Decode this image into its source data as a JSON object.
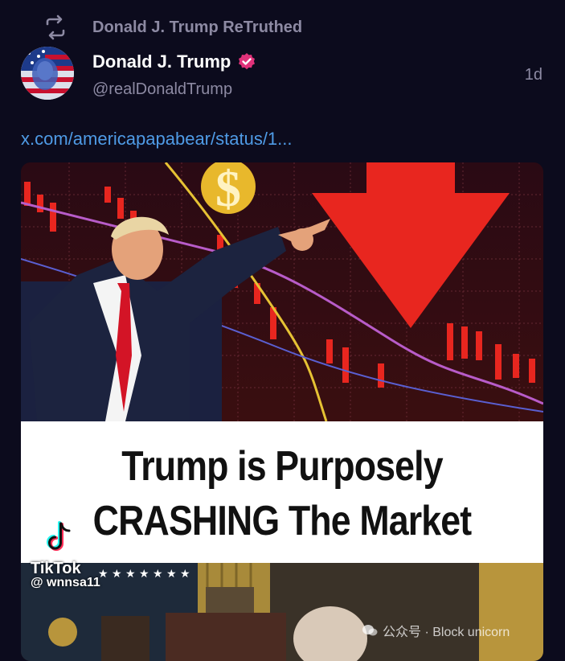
{
  "post": {
    "retruth_label": "Donald J. Trump ReTruthed",
    "author_name": "Donald J. Trump",
    "author_handle": "@realDonaldTrump",
    "timestamp": "1d",
    "link_text": "x.com/americapapabear/status/1..."
  },
  "media": {
    "caption_line1": "Trump is Purposely",
    "caption_line2": "CRASHING The Market",
    "tiktok_brand": "TikTok",
    "tiktok_user": "@ wnnsa11"
  },
  "watermark": {
    "text": "公众号 · Block unicorn"
  },
  "colors": {
    "background": "#0c0b1d",
    "link": "#4f9be6",
    "muted_text": "#8d8aa3",
    "verified_badge": "#e0327a",
    "chart_red": "#e8261f"
  },
  "icons": {
    "retruth": "retruth-icon",
    "verified": "verified-badge-icon"
  }
}
